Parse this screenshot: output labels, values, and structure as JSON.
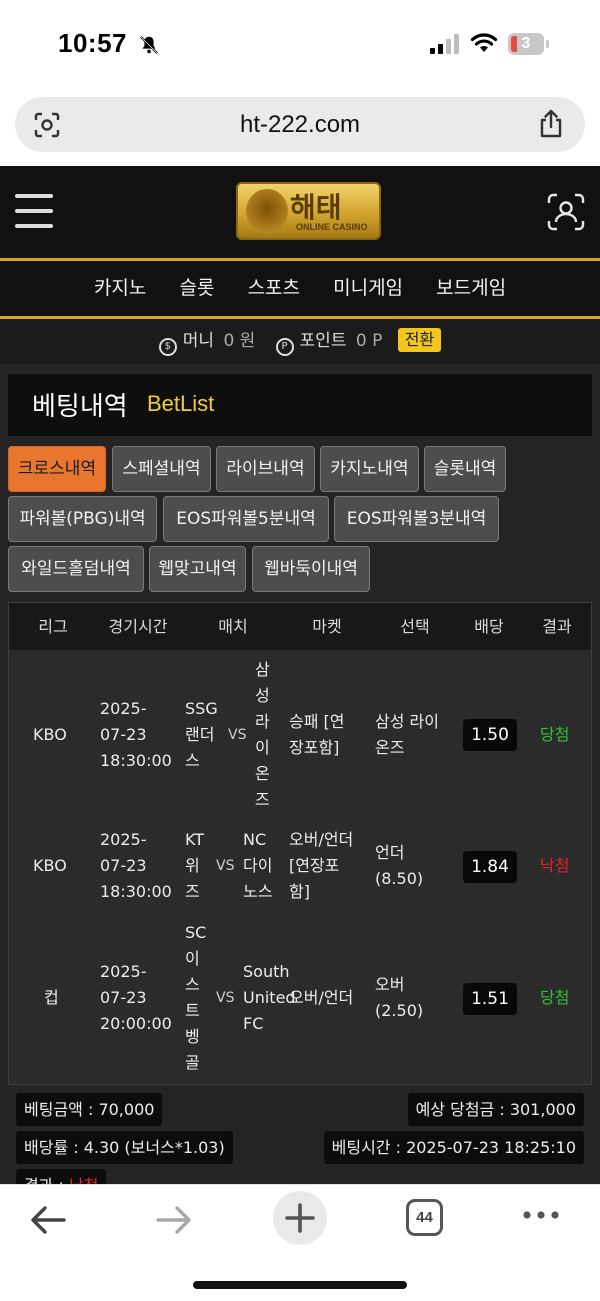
{
  "status_bar": {
    "time": "10:57",
    "battery": "3"
  },
  "browser": {
    "url": "ht-222.com",
    "tabs_count": "44"
  },
  "site": {
    "logo_main": "해태",
    "logo_sub": "ONLINE CASINO",
    "menu": [
      "카지노",
      "슬롯",
      "스포츠",
      "미니게임",
      "보드게임"
    ],
    "money_label": "머니",
    "money_value": "0 원",
    "point_label": "포인트",
    "point_value": "0 P",
    "convert_label": "전환"
  },
  "page": {
    "title_ko": "베팅내역",
    "title_en": "BetList",
    "tabs": [
      "크로스내역",
      "스페셜내역",
      "라이브내역",
      "카지노내역",
      "슬롯내역",
      "파워볼(PBG)내역",
      "EOS파워볼5분내역",
      "EOS파워볼3분내역",
      "와일드홀덤내역",
      "웹맞고내역",
      "웹바둑이내역"
    ],
    "table_headers": [
      "리그",
      "경기시간",
      "매치",
      "마켓",
      "선택",
      "배당",
      "결과"
    ],
    "rows": [
      {
        "league": "KBO",
        "time": [
          "2025-",
          "07-23",
          "18:30:00"
        ],
        "home": [
          "SSG",
          "랜더",
          "스"
        ],
        "vs": "VS",
        "away": [
          "삼",
          "성",
          "라",
          "이",
          "온",
          "즈"
        ],
        "market": [
          "승패 [연",
          "장포함]"
        ],
        "pick": [
          "삼성 라이",
          "온즈"
        ],
        "odds": "1.50",
        "result": "당첨"
      },
      {
        "league": "KBO",
        "time": [
          "2025-",
          "07-23",
          "18:30:00"
        ],
        "home": [
          "KT",
          "위",
          "즈"
        ],
        "vs": "VS",
        "away": [
          "NC",
          "다이",
          "노스"
        ],
        "market": [
          "오버/언더",
          "[연장포",
          "함]"
        ],
        "pick": [
          "언더",
          "(8.50)"
        ],
        "odds": "1.84",
        "result": "낙첨"
      },
      {
        "league": "컵",
        "time": [
          "2025-",
          "07-23",
          "20:00:00"
        ],
        "home": [
          "SC",
          "이",
          "스",
          "트",
          "벵",
          "골"
        ],
        "vs": "VS",
        "away": [
          "South",
          "United",
          "FC"
        ],
        "market": [
          "오버/언더"
        ],
        "pick": [
          "오버",
          "(2.50)"
        ],
        "odds": "1.51",
        "result": "당첨"
      }
    ],
    "summary": {
      "bet_amount": "베팅금액 : 70,000",
      "expected_win": "예상 당첨금 : 301,000",
      "odds_rate": "배당률 : 4.30 (보너스*1.03)",
      "bet_time": "베팅시간 : 2025-07-23 18:25:10",
      "result_label": "결과 :",
      "result_value": "낙첨"
    }
  },
  "colors": {
    "accent_gold": "#d8a520",
    "active_tab": "#e8762f",
    "win": "#2fbf3a",
    "lose": "#e02424"
  }
}
